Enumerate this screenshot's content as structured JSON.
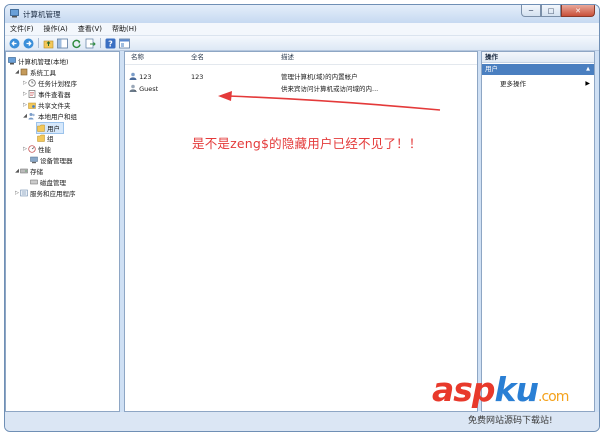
{
  "window": {
    "title": "计算机管理",
    "min_glyph": "─",
    "max_glyph": "□",
    "close_glyph": "✕"
  },
  "menu": [
    "文件(F)",
    "操作(A)",
    "查看(V)",
    "帮助(H)"
  ],
  "toolbar_icons": [
    "back-arrow-icon",
    "forward-arrow-icon",
    "up-folder-icon",
    "show-hide-tree-icon",
    "refresh-icon",
    "export-list-icon",
    "help-icon",
    "console-icon"
  ],
  "tree": {
    "root": "计算机管理(本地)",
    "system_tools": "系统工具",
    "task_scheduler": "任务计划程序",
    "event_viewer": "事件查看器",
    "shared_folders": "共享文件夹",
    "local_users_groups": "本地用户和组",
    "users": "用户",
    "groups": "组",
    "performance": "性能",
    "device_manager": "设备管理器",
    "storage": "存储",
    "disk_management": "磁盘管理",
    "services_apps": "服务和应用程序"
  },
  "list": {
    "columns": {
      "name": "名称",
      "fullname": "全名",
      "description": "描述"
    },
    "rows": [
      {
        "name": "123",
        "fullname": "123",
        "description": "管理计算机(域)的内置帐户"
      },
      {
        "name": "Guest",
        "fullname": "",
        "description": "供来宾访问计算机或访问域的内..."
      }
    ]
  },
  "actions": {
    "header": "操作",
    "section": "用户",
    "section_arrow": "▲",
    "more": "更多操作",
    "more_arrow": "▶"
  },
  "annotation": "是不是zeng$的隐藏用户已经不见了！！",
  "annotation_color": "#e43a3a",
  "watermark": {
    "part1": "asp",
    "part2": "ku",
    "part3": ".com",
    "sub": "免费网站源码下载站!"
  }
}
